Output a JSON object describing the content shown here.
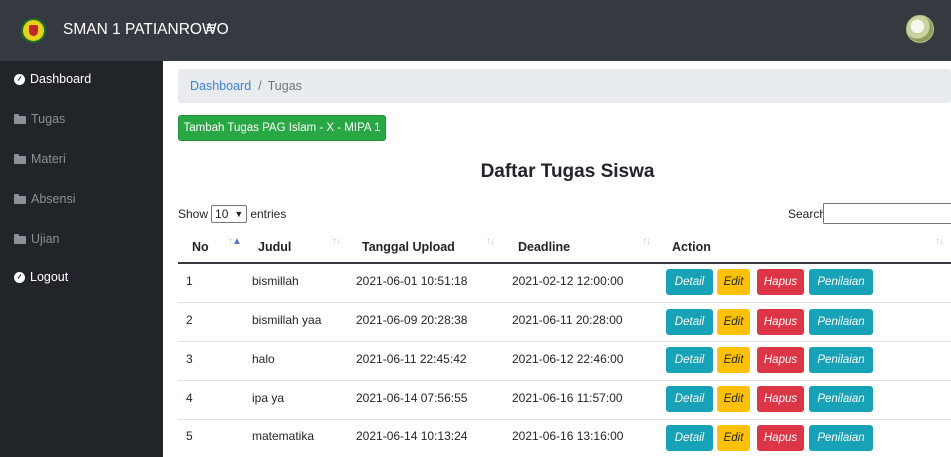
{
  "header": {
    "brand": "SMAN 1 PATIANROWO",
    "menu_icon": "≡"
  },
  "sidebar": {
    "items": [
      {
        "label": "Dashboard",
        "icon": "gauge-icon"
      },
      {
        "label": "Tugas",
        "icon": "folder-icon"
      },
      {
        "label": "Materi",
        "icon": "folder-icon"
      },
      {
        "label": "Absensi",
        "icon": "folder-icon"
      },
      {
        "label": "Ujian",
        "icon": "folder-icon"
      },
      {
        "label": "Logout",
        "icon": "gauge-icon"
      }
    ]
  },
  "breadcrumb": {
    "root": "Dashboard",
    "separator": "/",
    "current": "Tugas"
  },
  "add_button": "Tambah Tugas PAG Islam - X - MIPA 1",
  "page_title": "Daftar Tugas Siswa",
  "table_controls": {
    "show_label": "Show",
    "entries_value": "10",
    "entries_label": "entries",
    "search_label": "Search:",
    "search_value": ""
  },
  "table": {
    "columns": [
      "No",
      "Judul",
      "Tanggal Upload",
      "Deadline",
      "Action"
    ],
    "rows": [
      {
        "no": "1",
        "judul": "bismillah",
        "upload": "2021-06-01 10:51:18",
        "deadline": "2021-02-12 12:00:00"
      },
      {
        "no": "2",
        "judul": "bismillah yaa",
        "upload": "2021-06-09 20:28:38",
        "deadline": "2021-06-11 20:28:00"
      },
      {
        "no": "3",
        "judul": "halo",
        "upload": "2021-06-11 22:45:42",
        "deadline": "2021-06-12 22:46:00"
      },
      {
        "no": "4",
        "judul": "ipa ya",
        "upload": "2021-06-14 07:56:55",
        "deadline": "2021-06-16 11:57:00"
      },
      {
        "no": "5",
        "judul": "matematika",
        "upload": "2021-06-14 10:13:24",
        "deadline": "2021-06-16 13:16:00"
      }
    ],
    "actions": {
      "detail": "Detail",
      "edit": "Edit",
      "hapus": "Hapus",
      "penilaian": "Penilaian"
    }
  },
  "colors": {
    "topbar": "#343a40",
    "sidebar": "#212529",
    "success": "#28a745",
    "info": "#17a2b8",
    "warning": "#ffc107",
    "danger": "#dc3545",
    "link": "#3b82d6"
  }
}
